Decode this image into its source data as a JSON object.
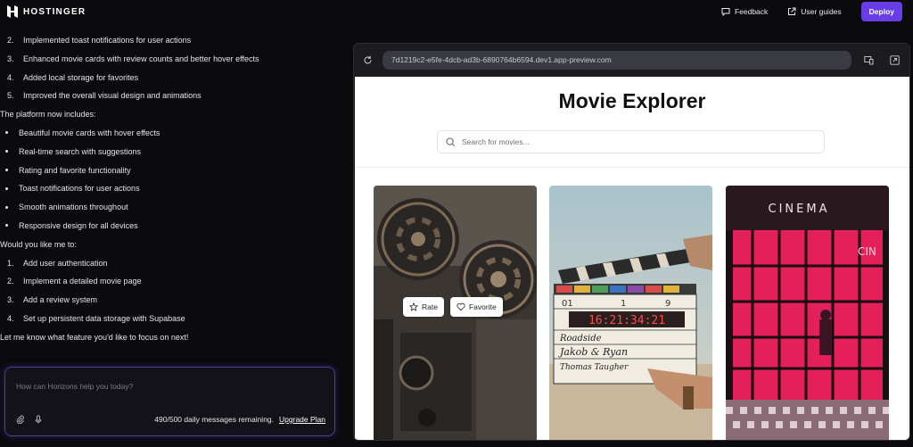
{
  "topbar": {
    "brand": "HOSTINGER",
    "feedback": "Feedback",
    "user_guides": "User guides",
    "deploy": "Deploy"
  },
  "chat": {
    "lines": [
      {
        "type": "num",
        "marker": "2.",
        "text": "Implemented toast notifications for user actions"
      },
      {
        "type": "num",
        "marker": "3.",
        "text": "Enhanced movie cards with review counts and better hover effects"
      },
      {
        "type": "num",
        "marker": "4.",
        "text": "Added local storage for favorites"
      },
      {
        "type": "num",
        "marker": "5.",
        "text": "Improved the overall visual design and animations"
      },
      {
        "type": "text",
        "marker": "",
        "text": "The platform now includes:"
      },
      {
        "type": "bullet",
        "marker": "",
        "text": "Beautiful movie cards with hover effects"
      },
      {
        "type": "bullet",
        "marker": "",
        "text": "Real-time search with suggestions"
      },
      {
        "type": "bullet",
        "marker": "",
        "text": "Rating and favorite functionality"
      },
      {
        "type": "bullet",
        "marker": "",
        "text": "Toast notifications for user actions"
      },
      {
        "type": "bullet",
        "marker": "",
        "text": "Smooth animations throughout"
      },
      {
        "type": "bullet",
        "marker": "",
        "text": "Responsive design for all devices"
      },
      {
        "type": "text",
        "marker": "",
        "text": "Would you like me to:"
      },
      {
        "type": "num",
        "marker": "1.",
        "text": "Add user authentication"
      },
      {
        "type": "num",
        "marker": "2.",
        "text": "Implement a detailed movie page"
      },
      {
        "type": "num",
        "marker": "3.",
        "text": "Add a review system"
      },
      {
        "type": "num",
        "marker": "4.",
        "text": "Set up persistent data storage with Supabase"
      },
      {
        "type": "text",
        "marker": "",
        "text": "Let me know what feature you'd like to focus on next!"
      }
    ]
  },
  "composer": {
    "placeholder": "How can Horizons help you today?",
    "quota": "490/500 daily messages remaining.",
    "upgrade": "Upgrade Plan"
  },
  "preview": {
    "url": "7d1219c2-e5fe-4dcb-ad3b-6890764b6594.dev1.app-preview.com",
    "app_title": "Movie Explorer",
    "search_placeholder": "Search for movies...",
    "rate_label": "Rate",
    "favorite_label": "Favorite",
    "clapper": {
      "numbers": "16:21:34:21",
      "line1": "Roadside",
      "line2": "Jakob & Ryan",
      "line3": "Thomas Taugher",
      "top_a": "01",
      "top_b": "1",
      "top_c": "9"
    },
    "cinema_sign": "CINEMA",
    "cinema_side": "CIN"
  },
  "colors": {
    "accent": "#673de6",
    "background": "#0b0b0e",
    "panel": "#1b1b20"
  }
}
